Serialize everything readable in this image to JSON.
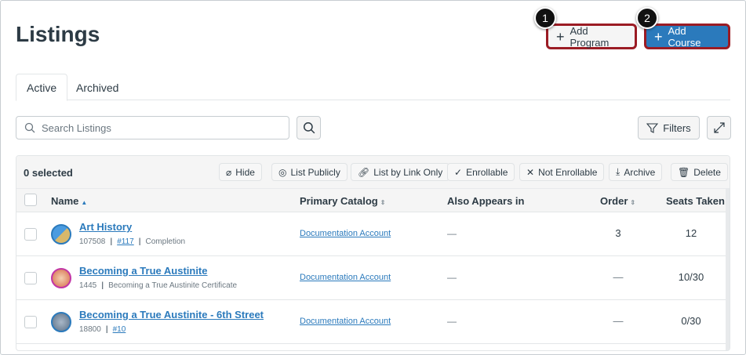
{
  "page_title": "Listings",
  "buttons": {
    "add_program": "Add Program",
    "add_course": "Add Course",
    "search": "Search",
    "filters": "Filters",
    "expand": "Expand"
  },
  "badges": [
    "1",
    "2"
  ],
  "tabs": [
    "Active",
    "Archived"
  ],
  "search": {
    "placeholder": "Search Listings",
    "value": ""
  },
  "toolbar": {
    "selected": "0 selected",
    "actions": [
      "Hide",
      "List Publicly",
      "List by Link Only",
      "Enrollable",
      "Not Enrollable",
      "Archive",
      "Delete"
    ]
  },
  "columns": [
    "Name",
    "Primary Catalog",
    "Also Appears in",
    "Order",
    "Seats Taken"
  ],
  "rows": [
    {
      "name": "Art History",
      "id": "107508",
      "link": "#117",
      "extra": "Completion",
      "catalog": "Documentation Account",
      "also": "—",
      "order": "3",
      "seats": "12"
    },
    {
      "name": "Becoming a True Austinite",
      "id": "1445",
      "extra": "Becoming a True Austinite Certificate",
      "catalog": "Documentation Account",
      "also": "—",
      "order": "—",
      "seats": "10/30"
    },
    {
      "name": "Becoming a True Austinite - 6th Street",
      "id": "18800",
      "link": "#10",
      "catalog": "Documentation Account",
      "also": "—",
      "order": "—",
      "seats": "0/30"
    }
  ],
  "colors": {
    "accent": "#2b7abc",
    "highlight": "#9b1c24"
  }
}
